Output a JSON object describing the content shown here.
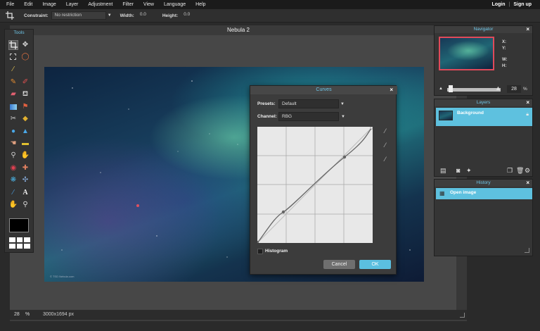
{
  "menubar": {
    "items": [
      "File",
      "Edit",
      "Image",
      "Layer",
      "Adjustment",
      "Filter",
      "View",
      "Language",
      "Help"
    ],
    "login": "Login",
    "separator": "|",
    "signup": "Sign up"
  },
  "toolbar": {
    "constraint_label": "Constraint:",
    "constraint_value": "No restriction",
    "width_label": "Width:",
    "width_value": "0.0",
    "height_label": "Height:",
    "height_value": "0.0"
  },
  "document": {
    "title": "Nebula 2",
    "watermark": "© TSD Nebula.com"
  },
  "status": {
    "zoom": "28",
    "zoom_unit": "%",
    "dimensions": "3000x1694 px"
  },
  "tools": {
    "title": "Tools",
    "foreground_color": "#000000"
  },
  "curves": {
    "title": "Curves",
    "presets_label": "Presets:",
    "presets_value": "Default",
    "channel_label": "Channel:",
    "channel_value": "RBG",
    "histogram_label": "Histogram",
    "histogram_checked": false,
    "cancel_label": "Cancel",
    "ok_label": "OK",
    "close_label": "×"
  },
  "navigator": {
    "title": "Navigator",
    "x_label": "X:",
    "y_label": "Y:",
    "w_label": "W:",
    "h_label": "H:",
    "zoom_value": "28",
    "zoom_unit": "%",
    "close_label": "×"
  },
  "layers": {
    "title": "Layers",
    "items": [
      {
        "name": "Background",
        "locked": true
      }
    ],
    "close_label": "×"
  },
  "history": {
    "title": "History",
    "items": [
      {
        "label": "Open image"
      }
    ],
    "close_label": "×"
  },
  "colors": {
    "accent": "#5ec1df",
    "title_blue": "#6ec6e8",
    "ok_button": "#5bbfe0",
    "cancel_button": "#6f6f6f",
    "nav_border": "#e04a5a"
  }
}
